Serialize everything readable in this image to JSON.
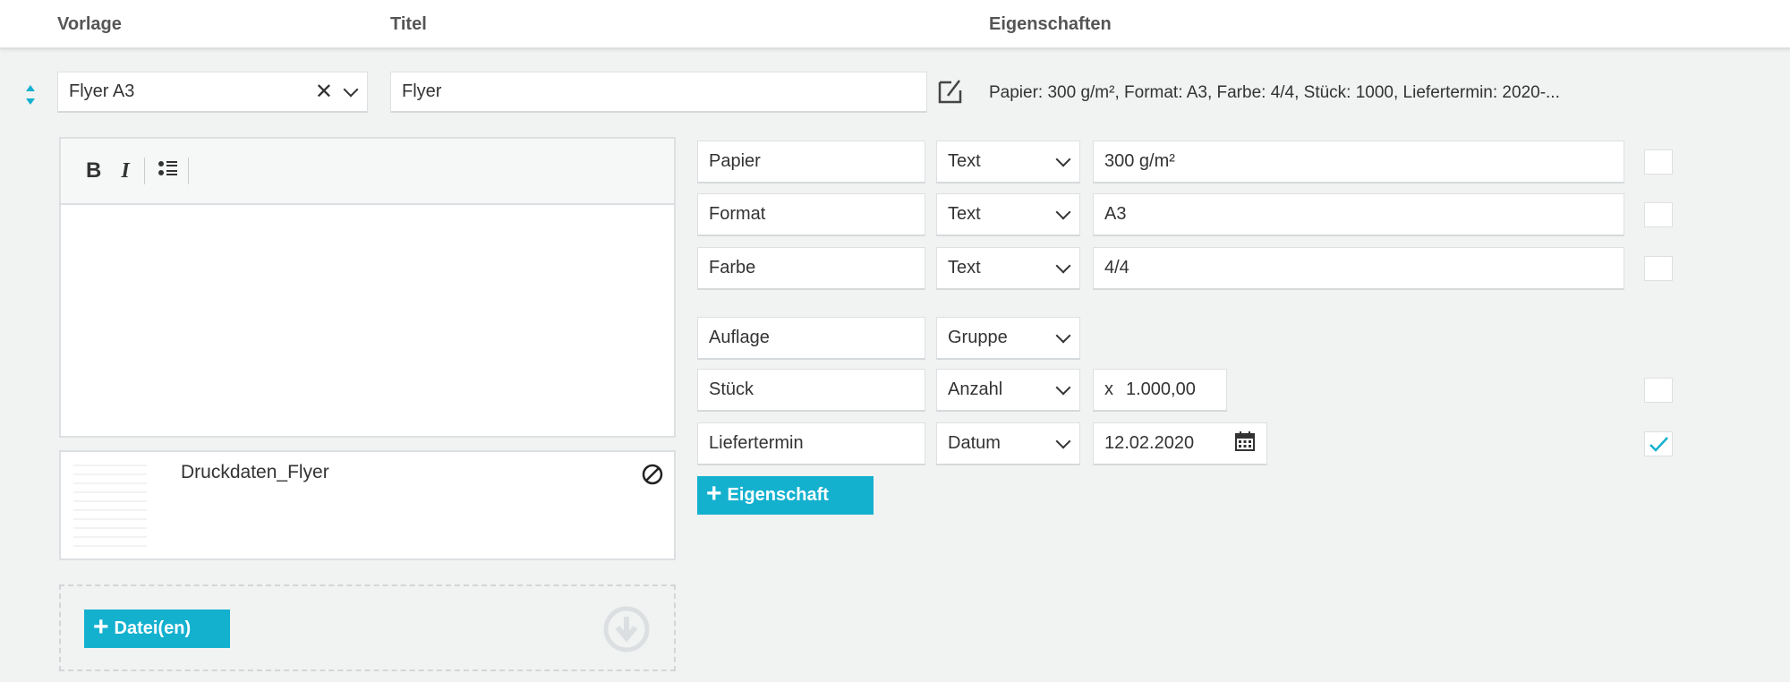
{
  "header": {
    "vorlage": "Vorlage",
    "titel": "Titel",
    "eigenschaften": "Eigenschaften"
  },
  "vorlage_select": {
    "value": "Flyer A3",
    "clear_icon": "close-icon",
    "dropdown_icon": "chevron-down-icon"
  },
  "titel_input": {
    "value": "Flyer"
  },
  "summary": "Papier: 300 g/m², Format: A3, Farbe: 4/4, Stück: 1000, Liefertermin: 2020-...",
  "editor": {
    "bold": "B",
    "italic": "I"
  },
  "file": {
    "name": "Druckdaten_Flyer"
  },
  "add_file_label": "Datei(en)",
  "add_property_label": "Eigenschaft",
  "properties": [
    {
      "name": "Papier",
      "type": "Text",
      "value": "300 g/m²",
      "checked": false
    },
    {
      "name": "Format",
      "type": "Text",
      "value": "A3",
      "checked": false
    },
    {
      "name": "Farbe",
      "type": "Text",
      "value": "4/4",
      "checked": false
    },
    {
      "name": "Auflage",
      "type": "Gruppe"
    },
    {
      "name": "Stück",
      "type": "Anzahl",
      "prefix": "x",
      "value": "1.000,00",
      "checked": false
    },
    {
      "name": "Liefertermin",
      "type": "Datum",
      "value": "12.02.2020",
      "checked": true
    }
  ],
  "colors": {
    "accent": "#14b1cf",
    "background": "#f1f2f2"
  }
}
